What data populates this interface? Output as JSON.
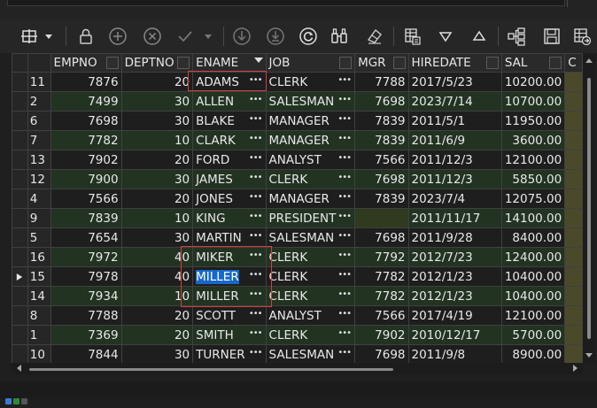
{
  "toolbar": {
    "buttons": [
      {
        "name": "pin-columns-icon",
        "icon": "pin-columns"
      },
      {
        "name": "dropdown-arrow-icon",
        "icon": "caret-down"
      },
      {
        "name": "lock-icon",
        "icon": "lock"
      },
      {
        "name": "add-record-icon",
        "icon": "plus-circle"
      },
      {
        "name": "delete-record-icon",
        "icon": "x-circle"
      },
      {
        "name": "post-edit-icon",
        "icon": "check"
      },
      {
        "name": "post-dropdown-icon",
        "icon": "caret-down"
      },
      {
        "name": "fetch-next-icon",
        "icon": "arrow-down-circle"
      },
      {
        "name": "fetch-all-icon",
        "icon": "arrow-down-bar-circle"
      },
      {
        "name": "refresh-icon",
        "icon": "refresh"
      },
      {
        "name": "binoculars-icon",
        "icon": "binoculars"
      },
      {
        "name": "clear-filter-icon",
        "icon": "eraser"
      },
      {
        "name": "single-record-view-icon",
        "icon": "table-view"
      },
      {
        "name": "sort-descending-icon",
        "icon": "triangle-down"
      },
      {
        "name": "sort-ascending-icon",
        "icon": "triangle-up"
      },
      {
        "name": "tree-view-icon",
        "icon": "tree"
      },
      {
        "name": "save-icon",
        "icon": "save"
      },
      {
        "name": "export-icon",
        "icon": "grid-export"
      }
    ]
  },
  "grid": {
    "columns": [
      "EMPNO",
      "DEPTNO",
      "ENAME",
      "JOB",
      "MGR",
      "HIREDATE",
      "SAL",
      "C"
    ],
    "rows": [
      {
        "n": "11",
        "empno": "7876",
        "deptno": "20",
        "ename": "ADAMS",
        "job": "CLERK",
        "mgr": "7788",
        "hiredate": "2017/5/23",
        "sal": "10200.00"
      },
      {
        "n": "2",
        "empno": "7499",
        "deptno": "30",
        "ename": "ALLEN",
        "job": "SALESMAN",
        "mgr": "7698",
        "hiredate": "2023/7/14",
        "sal": "10700.00"
      },
      {
        "n": "6",
        "empno": "7698",
        "deptno": "30",
        "ename": "BLAKE",
        "job": "MANAGER",
        "mgr": "7839",
        "hiredate": "2011/5/1",
        "sal": "11950.00"
      },
      {
        "n": "7",
        "empno": "7782",
        "deptno": "10",
        "ename": "CLARK",
        "job": "MANAGER",
        "mgr": "7839",
        "hiredate": "2011/6/9",
        "sal": "3600.00"
      },
      {
        "n": "13",
        "empno": "7902",
        "deptno": "20",
        "ename": "FORD",
        "job": "ANALYST",
        "mgr": "7566",
        "hiredate": "2011/12/3",
        "sal": "12100.00"
      },
      {
        "n": "12",
        "empno": "7900",
        "deptno": "30",
        "ename": "JAMES",
        "job": "CLERK",
        "mgr": "7698",
        "hiredate": "2011/12/3",
        "sal": "5850.00"
      },
      {
        "n": "4",
        "empno": "7566",
        "deptno": "20",
        "ename": "JONES",
        "job": "MANAGER",
        "mgr": "7839",
        "hiredate": "2023/7/4",
        "sal": "12075.00"
      },
      {
        "n": "9",
        "empno": "7839",
        "deptno": "10",
        "ename": "KING",
        "job": "PRESIDENT",
        "mgr": "",
        "hiredate": "2011/11/17",
        "sal": "14100.00"
      },
      {
        "n": "5",
        "empno": "7654",
        "deptno": "30",
        "ename": "MARTIN",
        "job": "SALESMAN",
        "mgr": "7698",
        "hiredate": "2011/9/28",
        "sal": "8400.00"
      },
      {
        "n": "16",
        "empno": "7972",
        "deptno": "40",
        "ename": "MIKER",
        "job": "CLERK",
        "mgr": "7792",
        "hiredate": "2012/7/23",
        "sal": "12400.00"
      },
      {
        "n": "15",
        "empno": "7978",
        "deptno": "40",
        "ename": "MILLER",
        "job": "CLERK",
        "mgr": "7782",
        "hiredate": "2012/1/23",
        "sal": "10400.00"
      },
      {
        "n": "14",
        "empno": "7934",
        "deptno": "10",
        "ename": "MILLER",
        "job": "CLERK",
        "mgr": "7782",
        "hiredate": "2012/1/23",
        "sal": "10400.00"
      },
      {
        "n": "8",
        "empno": "7788",
        "deptno": "20",
        "ename": "SCOTT",
        "job": "ANALYST",
        "mgr": "7566",
        "hiredate": "2017/4/19",
        "sal": "12100.00"
      },
      {
        "n": "1",
        "empno": "7369",
        "deptno": "20",
        "ename": "SMITH",
        "job": "CLERK",
        "mgr": "7902",
        "hiredate": "2010/12/17",
        "sal": "5700.00"
      },
      {
        "n": "10",
        "empno": "7844",
        "deptno": "30",
        "ename": "TURNER",
        "job": "SALESMAN",
        "mgr": "7698",
        "hiredate": "2011/9/8",
        "sal": "8900.00"
      }
    ],
    "current_row": "15",
    "selected_cell": "MILLER"
  },
  "colors": {
    "background": "#1f1f1f",
    "row_alt": "#223322",
    "selection": "#1769c9",
    "annotation": "#d04040"
  }
}
